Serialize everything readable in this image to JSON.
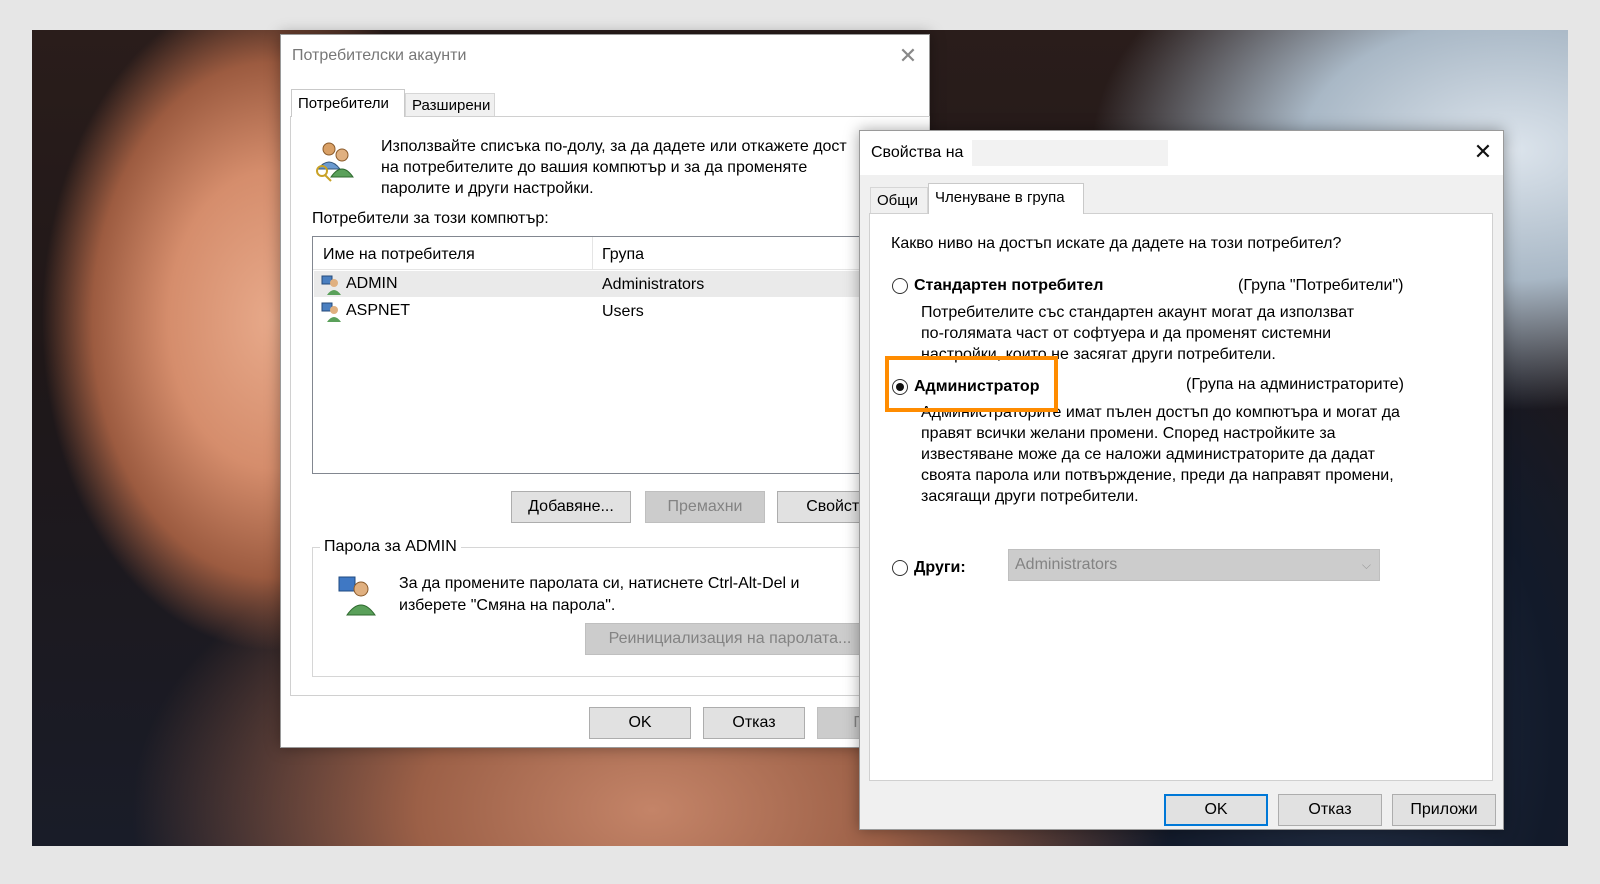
{
  "user_accounts": {
    "title": "Потребителски акаунти",
    "tabs": [
      "Потребители",
      "Разширени"
    ],
    "intro_lines": [
      "Използвайте списъка по-долу, за да дадете или откажете дост",
      "на потребителите до вашия компютър и за да променяте",
      "паролите и други настройки."
    ],
    "users_label": "Потребители за този компютър:",
    "columns": [
      "Име на потребителя",
      "Група"
    ],
    "rows": [
      {
        "name": "ADMIN",
        "group": "Administrators"
      },
      {
        "name": "ASPNET",
        "group": "Users"
      }
    ],
    "buttons": {
      "add": "Добавяне...",
      "remove": "Премахни",
      "properties": "Свойств"
    },
    "password_group": "Парола за ADMIN",
    "password_lines": [
      "За да промените паролата си, натиснете Ctrl-Alt-Del и",
      "изберете \"Смяна на парола\"."
    ],
    "reset_password": "Реинициализация на паролата...",
    "footer": {
      "ok": "OK",
      "cancel": "Отказ",
      "apply": "При"
    }
  },
  "properties": {
    "title": "Свойства на",
    "tabs": [
      "Общи",
      "Членуване в група"
    ],
    "question": "Какво ниво на достъп искате да дадете на този потребител?",
    "standard": {
      "label": "Стандартен потребител",
      "group": "(Група \"Потребители\")",
      "lines": [
        "Потребителите със стандартен акаунт могат да използват",
        "по-голямата част от софтуера и да променят системни",
        "настройки, които не засягат други потребители."
      ],
      "selected": false
    },
    "admin": {
      "label": "Администратор",
      "group": "(Група на администраторите)",
      "lines": [
        "Администраторите имат пълен достъп до компютъра и могат да",
        "правят всички желани промени. Според настройките за",
        "известяване може да се наложи администраторите да дадат",
        "своята парола или потвърждение, преди да направят промени,",
        "засягащи други потребители."
      ],
      "selected": true
    },
    "other": {
      "label": "Други:",
      "value": "Administrators",
      "selected": false
    },
    "footer": {
      "ok": "OK",
      "cancel": "Отказ",
      "apply": "Приложи"
    }
  },
  "colors": {
    "highlight": "#ff8c00",
    "default_button_border": "#0078d7"
  }
}
